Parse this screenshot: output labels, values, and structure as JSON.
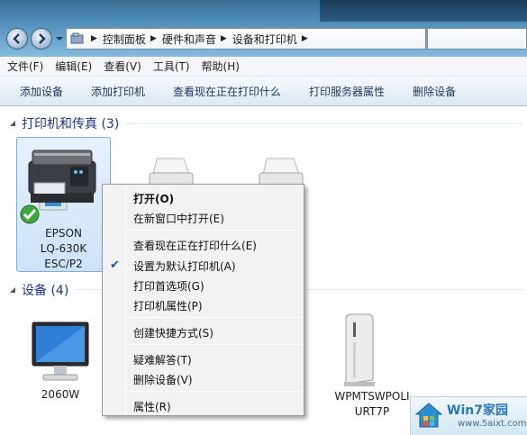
{
  "address": {
    "crumbs": [
      "控制面板",
      "硬件和声音",
      "设备和打印机"
    ]
  },
  "menubar": {
    "items": [
      "文件(F)",
      "编辑(E)",
      "查看(V)",
      "工具(T)",
      "帮助(H)"
    ]
  },
  "toolbar": {
    "items": [
      "添加设备",
      "添加打印机",
      "查看现在正在打印什么",
      "打印服务器属性",
      "删除设备"
    ]
  },
  "groups": {
    "printers": "打印机和传真 (3)",
    "devices": "设备 (4)"
  },
  "printers": [
    {
      "line1": "EPSON",
      "line2": "LQ-630K",
      "line3": "ESC/P2",
      "default": true,
      "selected": true
    }
  ],
  "devices": [
    {
      "label": "2060W",
      "icon": "monitor-icon"
    },
    {
      "label1": "WPMTSWPOLI",
      "label2": "URT7P",
      "icon": "computer-tower-icon"
    }
  ],
  "context_menu": {
    "items": [
      {
        "label": "打开(O)",
        "bold": true
      },
      {
        "label": "在新窗口中打开(E)"
      },
      {
        "label": "查看现在正在打印什么(E)"
      },
      {
        "label": "设置为默认打印机(A)",
        "checked": true
      },
      {
        "label": "打印首选项(G)"
      },
      {
        "label": "打印机属性(P)"
      },
      {
        "label": "创建快捷方式(S)"
      },
      {
        "label": "疑难解答(T)"
      },
      {
        "label": "删除设备(V)"
      },
      {
        "label": "属性(R)"
      }
    ]
  },
  "watermark": {
    "title": "Win7家园",
    "url": "www.5aixt.com"
  },
  "colors": {
    "group_header": "#1e3287",
    "toolbar_text": "#1e395b",
    "selection_bg": "#cde3fa"
  }
}
